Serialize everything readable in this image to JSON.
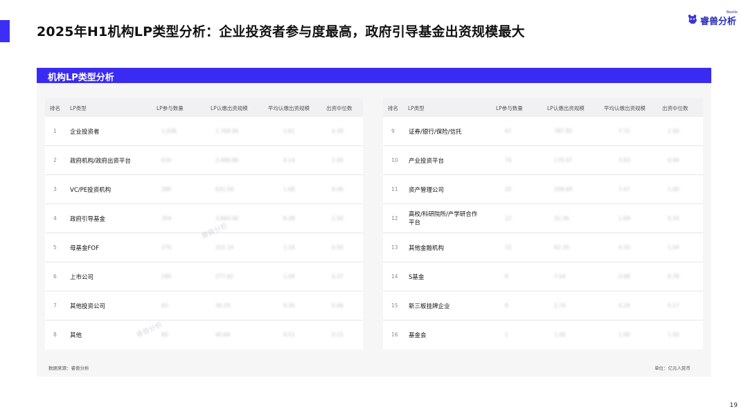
{
  "title": "2025年H1机构LP类型分析：企业投资者参与度最高，政府引导基金出资规模最大",
  "logo": {
    "icon": "bear-head-icon",
    "text": "睿兽分析",
    "en": "Beetle"
  },
  "panel": {
    "title": "机构LP类型分析"
  },
  "columns": [
    "排名",
    "LP类型",
    "LP参与数量",
    "LP认缴出资规模",
    "平均认缴出资规模",
    "出资中位数"
  ],
  "left_table": {
    "rows": [
      {
        "rank": "1",
        "type": "企业投资者",
        "count": "1,038",
        "total": "1,769.90",
        "avg": "1.61",
        "median": "0.30"
      },
      {
        "rank": "2",
        "type": "政府机构/政府出资平台",
        "count": "634",
        "total": "2,496.86",
        "avg": "4.14",
        "median": "1.00"
      },
      {
        "rank": "3",
        "type": "VC/PE投资机构",
        "count": "390",
        "total": "632.59",
        "avg": "1.68",
        "median": "0.46"
      },
      {
        "rank": "4",
        "type": "政府引导基金",
        "count": "354",
        "total": "3,664.00",
        "avg": "6.38",
        "median": "1.50"
      },
      {
        "rank": "5",
        "type": "母基金FOF",
        "count": "270",
        "total": "322.14",
        "avg": "1.16",
        "median": "0.50"
      },
      {
        "rank": "6",
        "type": "上市公司",
        "count": "180",
        "total": "277.62",
        "avg": "1.09",
        "median": "0.37"
      },
      {
        "rank": "7",
        "type": "其他投资公司",
        "count": "83",
        "total": "30.20",
        "avg": "0.30",
        "median": "0.06"
      },
      {
        "rank": "8",
        "type": "其他",
        "count": "60",
        "total": "40.66",
        "avg": "0.51",
        "median": "0.15"
      }
    ]
  },
  "right_table": {
    "rows": [
      {
        "rank": "9",
        "type": "证券/银行/保险/信托",
        "count": "67",
        "total": "787.85",
        "avg": "7.72",
        "median": "2.00"
      },
      {
        "rank": "10",
        "type": "产业投资平台",
        "count": "79",
        "total": "170.47",
        "avg": "3.83",
        "median": "0.94"
      },
      {
        "rank": "11",
        "type": "资产管理公司",
        "count": "25",
        "total": "209.69",
        "avg": "7.47",
        "median": "1.00"
      },
      {
        "rank": "12",
        "type": "高校/科研院所/产学研合作平台",
        "count": "22",
        "total": "32.36",
        "avg": "1.09",
        "median": "0.20"
      },
      {
        "rank": "13",
        "type": "其他金融机构",
        "count": "15",
        "total": "82.29",
        "avg": "4.20",
        "median": "1.04"
      },
      {
        "rank": "14",
        "type": "S基金",
        "count": "8",
        "total": "7.04",
        "avg": "0.88",
        "median": "0.78"
      },
      {
        "rank": "15",
        "type": "新三板挂牌企业",
        "count": "8",
        "total": "2.74",
        "avg": "0.34",
        "median": "0.17"
      },
      {
        "rank": "16",
        "type": "基金会",
        "count": "1",
        "total": "1.00",
        "avg": "1.00",
        "median": "1.00"
      }
    ]
  },
  "source_note": "数据来源：睿兽分析",
  "unit_note": "单位：亿元人民币",
  "watermark": "睿兽分析",
  "page_number": "19"
}
